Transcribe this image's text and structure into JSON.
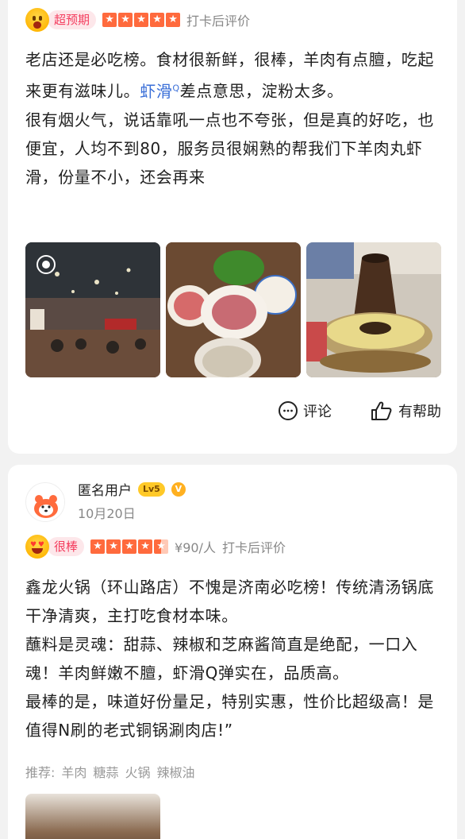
{
  "review1": {
    "badge_label": "超预期",
    "stars": 5,
    "checkin_text": "打卡后评价",
    "paragraph1_a": "老店还是必吃榜。食材很新鲜，很棒，羊肉有点膻，吃起来更有滋味儿。",
    "link_text": "虾滑",
    "paragraph1_b": "差点意思，淀粉太多。",
    "paragraph2": "很有烟火气，说话靠吼一点也不夸张，但是真的好吃，也便宜，人均不到80，服务员很娴熟的帮我们下羊肉丸虾滑，份量不小，还会再来",
    "photos": [
      "restaurant-interior-photo",
      "hotpot-ingredients-photo",
      "copper-hotpot-photo"
    ],
    "comment_label": "评论",
    "helpful_label": "有帮助"
  },
  "review2": {
    "username": "匿名用户",
    "level": "Lv5",
    "verified": "V",
    "date": "10月20日",
    "badge_label": "很棒",
    "stars": 4.5,
    "price": "¥90/人",
    "checkin_text": "打卡后评价",
    "line1": "鑫龙火锅（环山路店）不愧是济南必吃榜！传统清汤锅底干净清爽，主打吃食材本味。",
    "line2": "蘸料是灵魂：甜蒜、辣椒和芝麻酱简直是绝配，一口入魂！羊肉鲜嫩不膻，虾滑Q弹实在，品质高。",
    "line3": "最棒的是，味道好份量足，特别实惠，性价比超级高！是值得N刷的老式铜锅涮肉店!”",
    "tags_label": "推荐:",
    "tags": [
      "羊肉",
      "糖蒜",
      "火锅",
      "辣椒油"
    ]
  },
  "colors": {
    "accent": "#f43e5f",
    "star": "#ff6a3d",
    "link": "#3a6fd8"
  }
}
